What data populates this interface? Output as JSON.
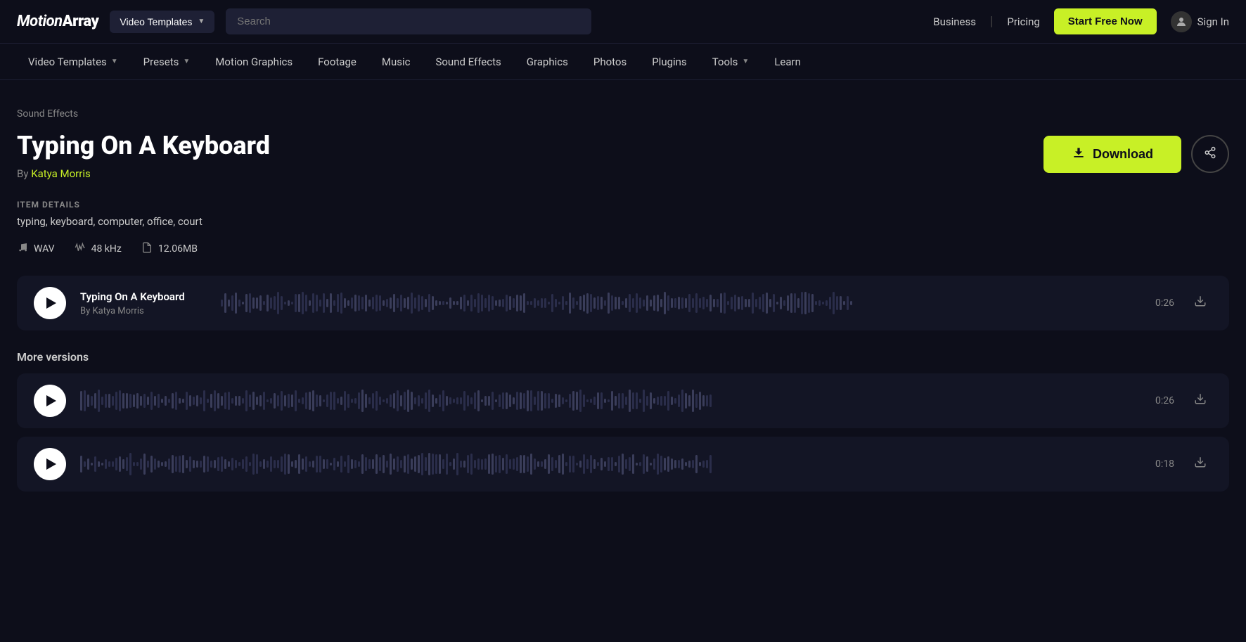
{
  "logo": {
    "text_italic": "Motion",
    "text_bold": "Array"
  },
  "top_nav": {
    "dropdown_label": "Video Templates",
    "search_placeholder": "Search",
    "business_label": "Business",
    "pricing_label": "Pricing",
    "start_free_label": "Start Free Now",
    "sign_in_label": "Sign In"
  },
  "secondary_nav": {
    "items": [
      {
        "label": "Video Templates",
        "has_dropdown": true
      },
      {
        "label": "Presets",
        "has_dropdown": true
      },
      {
        "label": "Motion Graphics",
        "has_dropdown": false
      },
      {
        "label": "Footage",
        "has_dropdown": false
      },
      {
        "label": "Music",
        "has_dropdown": false
      },
      {
        "label": "Sound Effects",
        "has_dropdown": false
      },
      {
        "label": "Graphics",
        "has_dropdown": false
      },
      {
        "label": "Photos",
        "has_dropdown": false
      },
      {
        "label": "Plugins",
        "has_dropdown": false
      },
      {
        "label": "Tools",
        "has_dropdown": true
      },
      {
        "label": "Learn",
        "has_dropdown": false
      }
    ]
  },
  "breadcrumb": "Sound Effects",
  "page": {
    "title": "Typing On A Keyboard",
    "by_prefix": "By",
    "author": "Katya Morris",
    "download_label": "Download",
    "share_icon": "↻"
  },
  "item_details": {
    "section_label": "ITEM DETAILS",
    "tags": "typing, keyboard, computer, office, court",
    "format": "WAV",
    "sample_rate": "48 kHz",
    "file_size": "12.06MB"
  },
  "audio_player": {
    "track_title": "Typing On A Keyboard",
    "track_author": "By Katya Morris",
    "duration": "0:26"
  },
  "more_versions": {
    "label": "More versions",
    "items": [
      {
        "duration": "0:26"
      },
      {
        "duration": "0:18"
      }
    ]
  },
  "colors": {
    "accent": "#c8f026",
    "bg": "#0d0e1a",
    "surface": "#131525",
    "text_muted": "#888888",
    "text": "#ffffff"
  }
}
